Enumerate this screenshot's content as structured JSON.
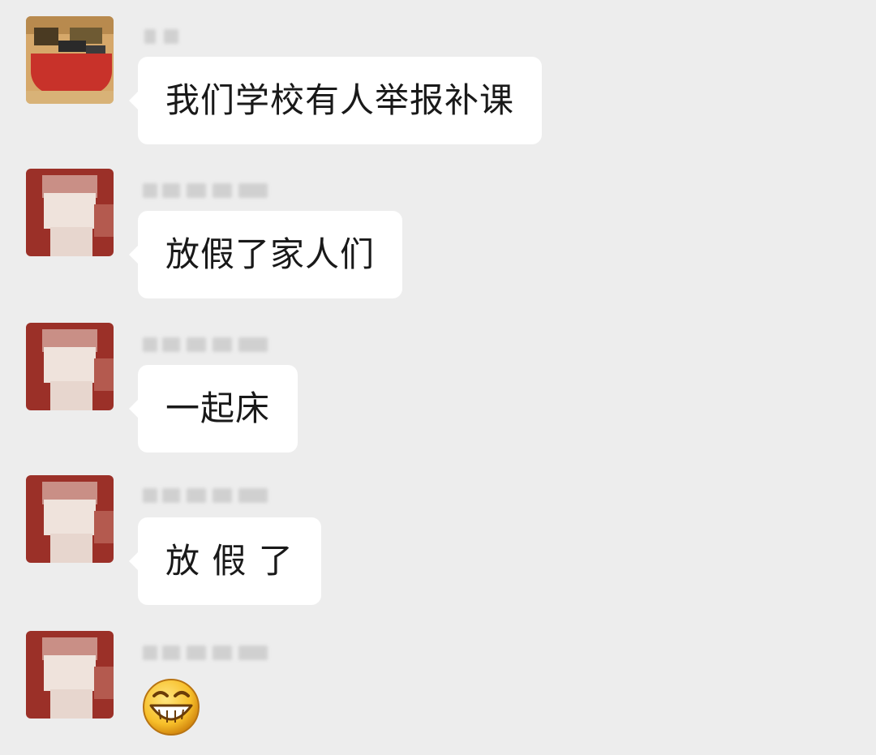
{
  "colors": {
    "background": "#ededed",
    "bubble": "#ffffff",
    "text": "#191919",
    "avatar_primary": "#9b3028",
    "avatar_first": "#c8322a"
  },
  "messages": [
    {
      "sender": "",
      "text": "我们学校有人举报补课",
      "type": "text",
      "avatar": "avatar-food-icon"
    },
    {
      "sender": "",
      "text": "放假了家人们",
      "type": "text",
      "avatar": "avatar-person-icon"
    },
    {
      "sender": "",
      "text": "一起床",
      "type": "text",
      "avatar": "avatar-person-icon"
    },
    {
      "sender": "",
      "text": "放 假 了",
      "type": "text",
      "avatar": "avatar-person-icon"
    },
    {
      "sender": "",
      "text": "",
      "type": "emoji",
      "emoji": "grinning-laugh-emoji-icon",
      "avatar": "avatar-person-icon"
    }
  ]
}
